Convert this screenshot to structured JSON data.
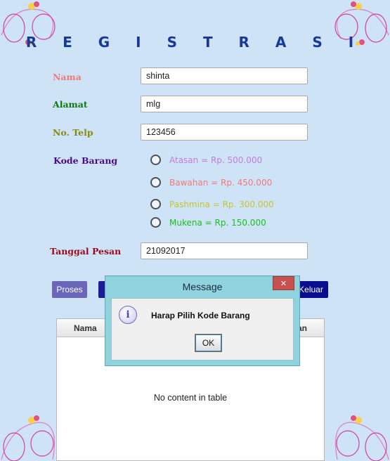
{
  "title": "R E G I S T R A S I",
  "form": {
    "nama_label": "Nama",
    "nama_value": "shinta",
    "alamat_label": "Alamat",
    "alamat_value": "mlg",
    "telp_label": "No. Telp",
    "telp_value": "123456",
    "kode_label": "Kode Barang",
    "options": [
      {
        "label": "Atasan = Rp. 500.000",
        "color": "#c67ae0"
      },
      {
        "label": "Bawahan = Rp. 450.000",
        "color": "#f07a7a"
      },
      {
        "label": "Pashmina = Rp. 300.000",
        "color": "#c4c432"
      },
      {
        "label": "Mukena = Rp. 150.000",
        "color": "#15c21b"
      }
    ],
    "tanggal_label": "Tanggal Pesan",
    "tanggal_value": "21092017"
  },
  "buttons": {
    "proses": "Proses",
    "keluar": "Keluar"
  },
  "table": {
    "headers": [
      "Nama",
      "an"
    ],
    "empty": "No content in table"
  },
  "dialog": {
    "title": "Message",
    "close": "✕",
    "message": "Harap Pilih Kode Barang",
    "ok": "OK",
    "icon": "info-icon"
  },
  "colors": {
    "background": "#cfe3f7",
    "title": "#16399a",
    "nama": "#f07a7a",
    "alamat": "#0d7a0d",
    "telp": "#8a8a10",
    "kode": "#4a0a8a",
    "tanggal": "#9c0a1a",
    "dialog_frame": "#8fd3df"
  }
}
